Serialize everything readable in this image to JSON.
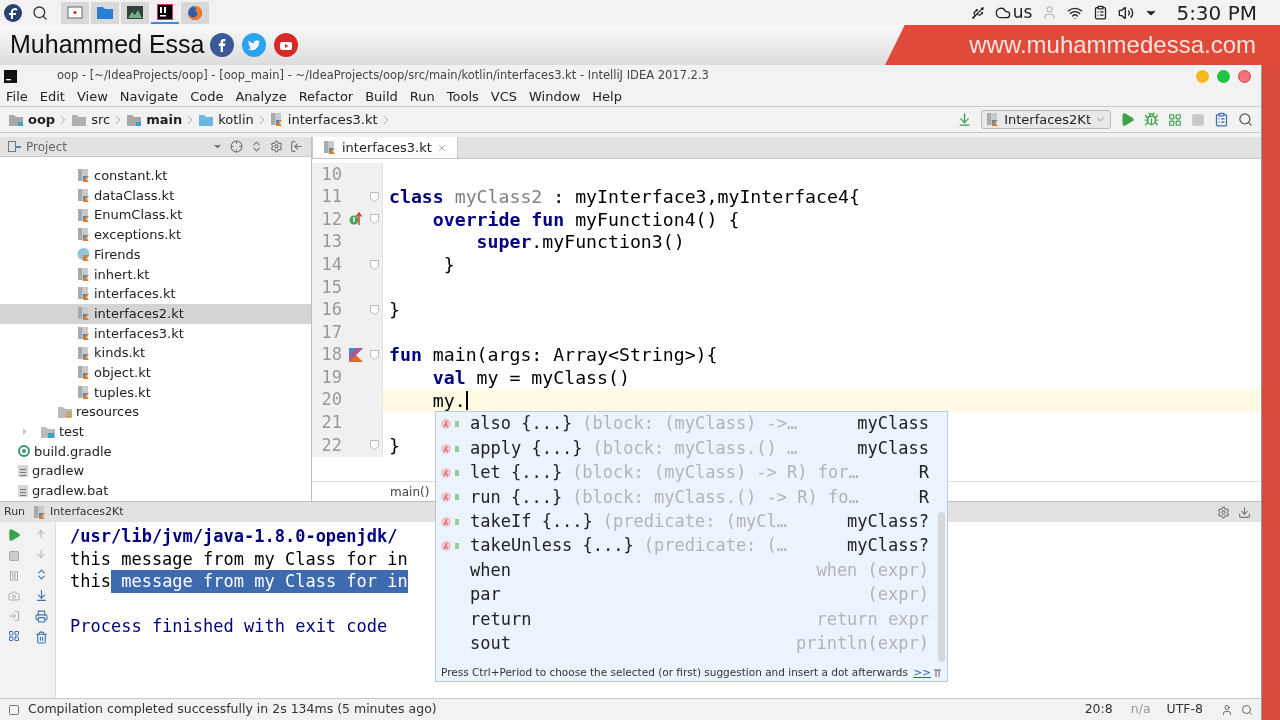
{
  "system_bar": {
    "taskbar": [
      {
        "kind": "screen",
        "selected": false
      },
      {
        "kind": "files",
        "selected": false
      },
      {
        "kind": "monitor",
        "selected": false
      },
      {
        "kind": "ide",
        "selected": true
      },
      {
        "kind": "browser",
        "selected": false
      }
    ],
    "keyboard_layout": "us",
    "clock": "5:30 PM"
  },
  "banner": {
    "name": "Muhammed Essa",
    "website": "www.muhammedessa.com"
  },
  "window": {
    "title": "oop - [~/IdeaProjects/oop] - [oop_main] - ~/IdeaProjects/oop/src/main/kotlin/interfaces3.kt - IntelliJ IDEA 2017.2.3"
  },
  "menu": [
    "File",
    "Edit",
    "View",
    "Navigate",
    "Code",
    "Analyze",
    "Refactor",
    "Build",
    "Run",
    "Tools",
    "VCS",
    "Window",
    "Help"
  ],
  "breadcrumbs": [
    {
      "label": "oop",
      "kind": "module"
    },
    {
      "label": "src",
      "kind": "folder"
    },
    {
      "label": "main",
      "kind": "module"
    },
    {
      "label": "kotlin",
      "kind": "source"
    },
    {
      "label": "interfaces3.kt",
      "kind": "file"
    }
  ],
  "run_config": "Interfaces2Kt",
  "project_panel": {
    "title": "Project",
    "tree": [
      {
        "children": [
          {
            "children": [
              {
                "children": [
                  {
                    "label": "constant.kt",
                    "kind": "kotlin",
                    "selected": false
                  },
                  {
                    "label": "dataClass.kt",
                    "kind": "kotlin",
                    "selected": false
                  },
                  {
                    "label": "EnumClass.kt",
                    "kind": "kotlin",
                    "selected": false
                  },
                  {
                    "label": "exceptions.kt",
                    "kind": "kotlin",
                    "selected": false
                  },
                  {
                    "label": "Firends",
                    "kind": "class",
                    "selected": false
                  },
                  {
                    "label": "inhert.kt",
                    "kind": "kotlin",
                    "selected": false
                  },
                  {
                    "label": "interfaces.kt",
                    "kind": "kotlin",
                    "selected": false
                  },
                  {
                    "label": "interfaces2.kt",
                    "kind": "kotlin",
                    "selected": true
                  },
                  {
                    "label": "interfaces3.kt",
                    "kind": "kotlin",
                    "selected": false
                  },
                  {
                    "label": "kinds.kt",
                    "kind": "kotlin",
                    "selected": false
                  },
                  {
                    "label": "object.kt",
                    "kind": "kotlin",
                    "selected": false
                  },
                  {
                    "label": "tuples.kt",
                    "kind": "kotlin",
                    "selected": false
                  }
                ]
              },
              {
                "label": "resources",
                "kind": "resources",
                "selected": false
              }
            ]
          },
          {
            "label": "test",
            "kind": "test",
            "selected": false,
            "expanded": false
          }
        ]
      },
      {
        "label": "build.gradle",
        "kind": "gradle",
        "selected": false
      },
      {
        "label": "gradlew",
        "kind": "text",
        "selected": false
      },
      {
        "label": "gradlew.bat",
        "kind": "text",
        "selected": false
      }
    ]
  },
  "editor": {
    "tabs": [
      {
        "label": "interfaces3.kt",
        "selected": true
      }
    ],
    "lines": [
      {
        "number": "10",
        "current": false
      },
      {
        "number": "11",
        "current": false,
        "fold": true,
        "tokens": [
          {
            "text": "class",
            "kind": "keyword"
          },
          {
            "text": " myClass2",
            "kind": "unused"
          },
          {
            "text": " : myInterface3,myInterface4{",
            "kind": "plain"
          }
        ]
      },
      {
        "number": "12",
        "current": false,
        "fold": true,
        "gutter": {
          "kind": "override"
        },
        "tokens": [
          {
            "text": "    override fun",
            "kind": "keyword"
          },
          {
            "text": " myFunction4() {",
            "kind": "plain"
          }
        ]
      },
      {
        "number": "13",
        "current": false,
        "tokens": [
          {
            "text": "        super",
            "kind": "keyword"
          },
          {
            "text": ".myFunction3()",
            "kind": "plain"
          }
        ]
      },
      {
        "number": "14",
        "current": false,
        "fold": true,
        "tokens": [
          {
            "text": "     }",
            "kind": "plain"
          }
        ]
      },
      {
        "number": "15",
        "current": false
      },
      {
        "number": "16",
        "current": false,
        "fold": true,
        "tokens": [
          {
            "text": "}",
            "kind": "plain"
          }
        ]
      },
      {
        "number": "17",
        "current": false
      },
      {
        "number": "18",
        "current": false,
        "fold": true,
        "gutter": {
          "kind": "run"
        },
        "tokens": [
          {
            "text": "fun",
            "kind": "keyword"
          },
          {
            "text": " main(args: Array<String>){",
            "kind": "plain"
          }
        ]
      },
      {
        "number": "19",
        "current": false,
        "tokens": [
          {
            "text": "    val",
            "kind": "keyword"
          },
          {
            "text": " my = myClass()",
            "kind": "plain"
          }
        ]
      },
      {
        "number": "20",
        "current": true,
        "tokens": [
          {
            "text": "    my.",
            "kind": "plain"
          }
        ]
      },
      {
        "number": "21",
        "current": false
      },
      {
        "number": "22",
        "current": false,
        "fold": true,
        "tokens": [
          {
            "text": "}",
            "kind": "plain"
          }
        ]
      }
    ],
    "breadcrumb": "main()"
  },
  "completion": {
    "items": [
      {
        "kind": "extension",
        "name": "also {...}",
        "detail": "(block: (myClass) ->…",
        "type": "myClass"
      },
      {
        "kind": "extension",
        "name": "apply {...}",
        "detail": "(block: myClass.() …",
        "type": "myClass"
      },
      {
        "kind": "extension",
        "name": "let {...}",
        "detail": "(block: (myClass) -> R) for…",
        "type": "R"
      },
      {
        "kind": "extension",
        "name": "run {...}",
        "detail": "(block: myClass.() -> R) fo…",
        "type": "R"
      },
      {
        "kind": "extension",
        "name": "takeIf {...}",
        "detail": "(predicate: (myCl…",
        "type": "myClass?"
      },
      {
        "kind": "extension",
        "name": "takeUnless {...}",
        "detail": "(predicate: (…",
        "type": "myClass?"
      },
      {
        "kind": "template",
        "name": "when",
        "detail": "when (expr)"
      },
      {
        "kind": "template",
        "name": "par",
        "detail": "(expr)"
      },
      {
        "kind": "template",
        "name": "return",
        "detail": "return expr"
      },
      {
        "kind": "template",
        "name": "sout",
        "detail": "println(expr)"
      }
    ],
    "hint": "Press Ctrl+Period to choose the selected (or first) suggestion and insert a dot afterwards",
    "hint_link": ">>"
  },
  "run_panel": {
    "title": "Run",
    "tab": "Interfaces2Kt",
    "output": [
      {
        "kind": "command",
        "text": "/usr/lib/jvm/java-1.8.0-openjdk/"
      },
      {
        "kind": "output",
        "text": "this message from my Class for in"
      },
      {
        "kind": "output",
        "text": "this",
        "selected_text": " message from my Class for in"
      },
      {
        "kind": "exit",
        "text": "Process finished with exit code "
      }
    ]
  },
  "status_bar": {
    "message": "Compilation completed successfully in 2s 134ms (5 minutes ago)",
    "position": "20:8",
    "line_separator": "n/a",
    "encoding": "UTF-8"
  }
}
